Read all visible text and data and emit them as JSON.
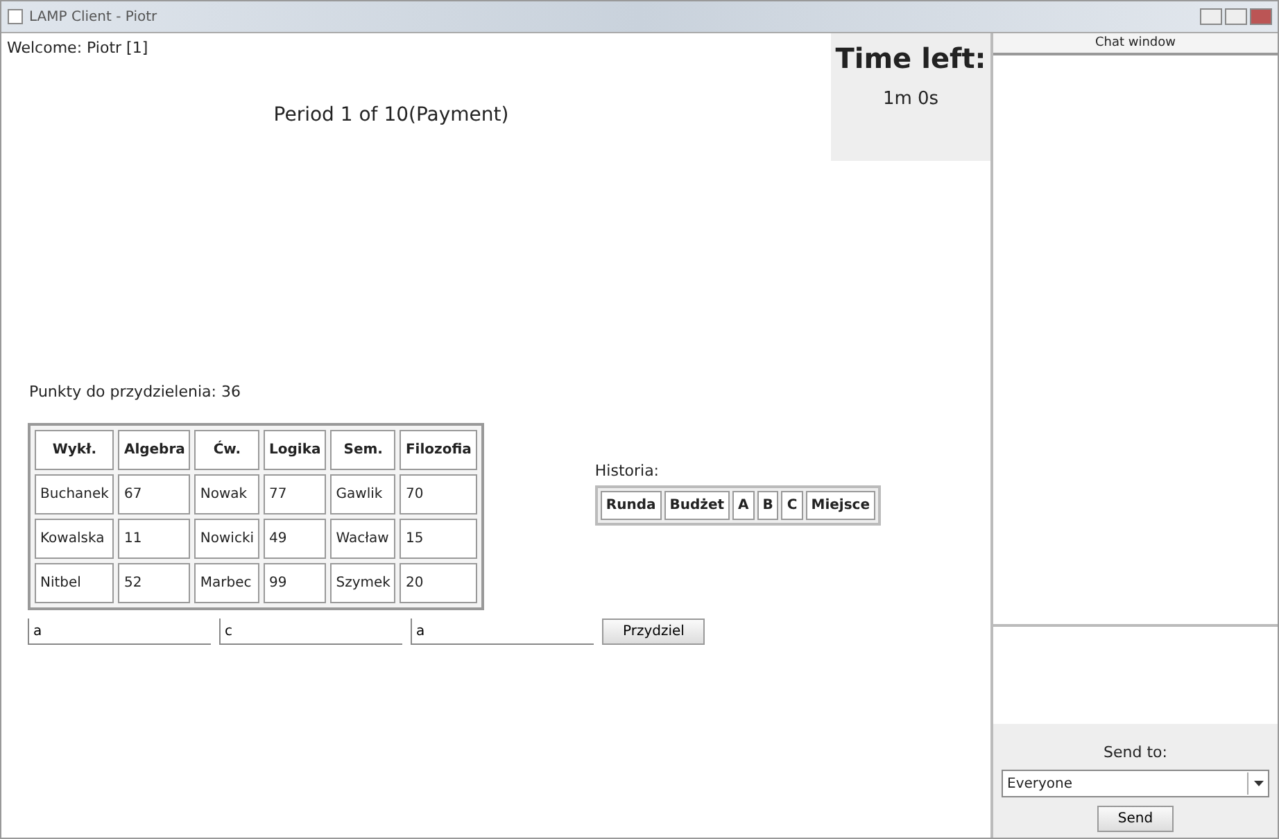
{
  "window": {
    "title": "LAMP Client - Piotr"
  },
  "welcome": "Welcome: Piotr [1]",
  "period": "Period 1 of 10(Payment)",
  "timer": {
    "label": "Time left:",
    "value": "1m 0s"
  },
  "points": "Punkty do przydzielenia: 36",
  "table": {
    "columns": [
      "Wykł.",
      "Algebra",
      "Ćw.",
      "Logika",
      "Sem.",
      "Filozofia"
    ],
    "rows": [
      [
        "Buchanek",
        "67",
        "Nowak",
        "77",
        "Gawlik",
        "70"
      ],
      [
        "Kowalska",
        "11",
        "Nowicki",
        "49",
        "Wacław",
        "15"
      ],
      [
        "Nitbel",
        "52",
        "Marbec",
        "99",
        "Szymek",
        "20"
      ]
    ]
  },
  "inputs": [
    {
      "value": "a"
    },
    {
      "value": "c"
    },
    {
      "value": "a"
    }
  ],
  "assign_button": "Przydziel",
  "history": {
    "label": "Historia:",
    "columns": [
      "Runda",
      "Budżet",
      "A",
      "B",
      "C",
      "Miejsce"
    ]
  },
  "chat": {
    "title": "Chat window",
    "send_to_label": "Send to:",
    "recipient": "Everyone",
    "send_button": "Send"
  }
}
